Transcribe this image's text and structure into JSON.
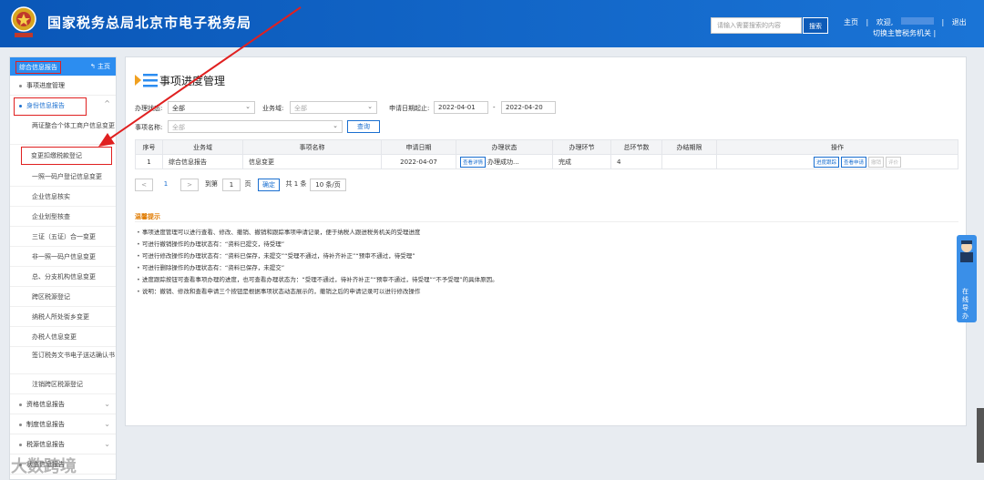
{
  "header": {
    "brand": "国家税务总局北京市电子税务局",
    "search_placeholder": "请输入需要搜索的内容",
    "search_btn": "搜索",
    "home": "主页",
    "welcome": "欢迎,",
    "exit": "退出",
    "switch_authority": "切换主管税务机关"
  },
  "sidebar": {
    "head": "综合信息报告",
    "home": "主页",
    "items": [
      {
        "label": "事项进度管理"
      },
      {
        "label": "身份信息报告"
      }
    ],
    "subs": [
      "两证整合个体工商户信息变更",
      "变更扣缴税款登记",
      "一照一码户登记信息变更",
      "企业信息核实",
      "企业划型核查",
      "三证（五证）合一变更",
      "非一照一码户信息变更",
      "总、分支机构信息变更",
      "跨区税源登记",
      "纳税人所处街乡变更",
      "办税人信息变更",
      "签订税务文书电子送达确认书",
      "注销跨区税源登记"
    ],
    "groups": [
      "资格信息报告",
      "制度信息报告",
      "税源信息报告",
      "状态信息报告"
    ]
  },
  "main": {
    "title": "事项进度管理",
    "filters": {
      "status_label": "办理状态:",
      "status_value": "全部",
      "domain_label": "业务域:",
      "domain_value": "全部",
      "date_label": "申请日期起止:",
      "date_from": "2022-04-01",
      "date_sep": "-",
      "date_to": "2022-04-20",
      "name_label": "事项名称:",
      "name_value": "全部",
      "query_btn": "查询"
    },
    "table": {
      "headers": [
        "序号",
        "业务域",
        "事项名称",
        "申请日期",
        "办理状态",
        "办理环节",
        "总环节数",
        "办结期限",
        "操作"
      ],
      "row": {
        "no": "1",
        "domain": "综合信息报告",
        "name": "信息变更",
        "date": "2022-04-07",
        "status_btn": "查看详情",
        "status": "办理成功...",
        "step": "完成",
        "total": "4",
        "deadline": "",
        "ops": [
          "进度跟踪",
          "查看申请",
          "撤销",
          "评价"
        ]
      }
    },
    "pager": {
      "current": "1",
      "goto": "到第",
      "page_input": "1",
      "page": "页",
      "confirm": "确定",
      "total": "共 1 条",
      "size": "10 条/页"
    },
    "tips_title": "温馨提示",
    "tips": [
      "事项进度管理可以进行查看、修改、撤销、撤销和跟踪事项申请记录，便于纳税人跟进税务机关的受理进度",
      "可进行撤销操作的办理状态有：“资料已提交，待受理”",
      "可进行修改操作的办理状态有：“资料已保存，未提交”“受理不通过，待补齐补正”“预审不通过，待受理”",
      "可进行删除操作的办理状态有：“资料已保存，未提交”",
      "进度跟踪按钮可查看事项办理的进度，也可查看办理状态为：“受理不通过，待补齐补正”“预审不通过，待受理”“不予受理”的具体原因。",
      "说明：撤销、修改和查看申请三个按钮是根据事项状态动态展示的，撤销之后的申请记录可以进行修改操作"
    ]
  },
  "float": {
    "label": "在线导办"
  },
  "watermark": "大数跨境"
}
